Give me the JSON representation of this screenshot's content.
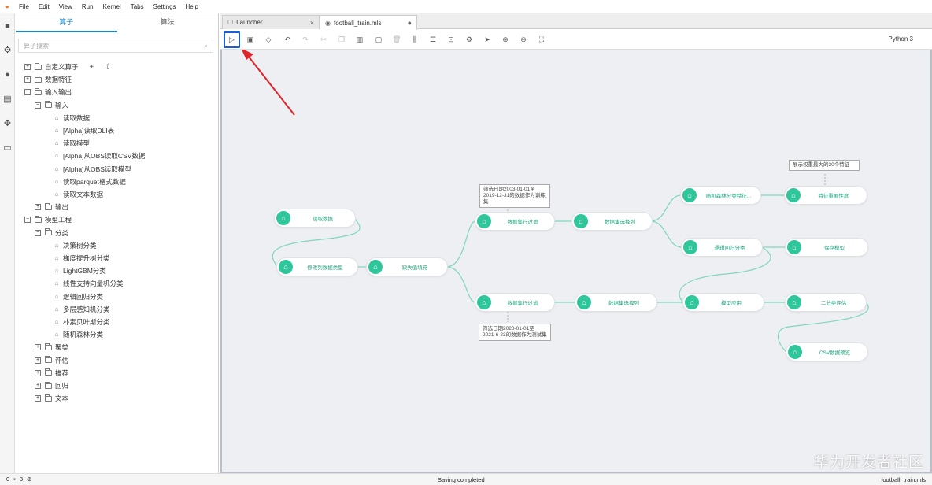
{
  "menubar": {
    "items": [
      "File",
      "Edit",
      "View",
      "Run",
      "Kernel",
      "Tabs",
      "Settings",
      "Help"
    ]
  },
  "sidebar": {
    "tabs": [
      "算子",
      "算法"
    ],
    "active_tab": "算子",
    "search_placeholder": "算子搜索",
    "tree": [
      {
        "label": "自定义算子",
        "expander": "+",
        "kind": "folder"
      },
      {
        "label": "数据特征",
        "expander": "+",
        "kind": "folder"
      },
      {
        "label": "输入输出",
        "expander": "−",
        "kind": "folder"
      },
      {
        "label": "输入",
        "expander": "−",
        "kind": "folder"
      },
      {
        "label": "读取数据",
        "kind": "leaf"
      },
      {
        "label": "[Alpha]读取DLI表",
        "kind": "leaf"
      },
      {
        "label": "读取模型",
        "kind": "leaf"
      },
      {
        "label": "[Alpha]从OBS读取CSV数据",
        "kind": "leaf"
      },
      {
        "label": "[Alpha]从OBS读取模型",
        "kind": "leaf"
      },
      {
        "label": "读取parquet格式数据",
        "kind": "leaf"
      },
      {
        "label": "读取文本数据",
        "kind": "leaf"
      },
      {
        "label": "输出",
        "expander": "+",
        "kind": "folder"
      },
      {
        "label": "模型工程",
        "expander": "−",
        "kind": "folder"
      },
      {
        "label": "分类",
        "expander": "−",
        "kind": "folder"
      },
      {
        "label": "决策树分类",
        "kind": "leaf"
      },
      {
        "label": "梯度提升树分类",
        "kind": "leaf"
      },
      {
        "label": "LightGBM分类",
        "kind": "leaf"
      },
      {
        "label": "线性支持向量机分类",
        "kind": "leaf"
      },
      {
        "label": "逻辑回归分类",
        "kind": "leaf"
      },
      {
        "label": "多层感知机分类",
        "kind": "leaf"
      },
      {
        "label": "朴素贝叶斯分类",
        "kind": "leaf"
      },
      {
        "label": "随机森林分类",
        "kind": "leaf"
      },
      {
        "label": "聚类",
        "expander": "+",
        "kind": "folder"
      },
      {
        "label": "评估",
        "expander": "+",
        "kind": "folder"
      },
      {
        "label": "推荐",
        "expander": "+",
        "kind": "folder"
      },
      {
        "label": "回归",
        "expander": "+",
        "kind": "folder"
      },
      {
        "label": "文本",
        "expander": "+",
        "kind": "folder"
      }
    ],
    "tree_actions": [
      "+",
      "⇧"
    ]
  },
  "doc_tabs": [
    {
      "label": "Launcher",
      "close": "×"
    },
    {
      "label": "football_train.mls",
      "close": "●"
    }
  ],
  "toolbar": {
    "kernel": "Python 3",
    "icons": [
      "run-icon",
      "save-icon",
      "eraser-icon",
      "undo-icon",
      "redo-icon",
      "cut-icon",
      "copy-icon",
      "paste-icon",
      "comment-icon",
      "delete-icon",
      "align-vertical-icon",
      "align-horizontal-icon",
      "export-icon",
      "settings-icon",
      "send-icon",
      "zoom-in-icon",
      "zoom-out-icon",
      "fit-icon"
    ]
  },
  "canvas": {
    "nodes": [
      {
        "id": "read",
        "label": "读取数据"
      },
      {
        "id": "cast",
        "label": "修改列数据类型"
      },
      {
        "id": "fill",
        "label": "缺失值填充"
      },
      {
        "id": "filter1",
        "label": "数据集行过滤"
      },
      {
        "id": "filter2",
        "label": "数据集行过滤"
      },
      {
        "id": "select1",
        "label": "数据集选择列"
      },
      {
        "id": "select2",
        "label": "数据集选择列"
      },
      {
        "id": "rfimp",
        "label": "随机森林分类特征..."
      },
      {
        "id": "lr",
        "label": "逻辑回归分类"
      },
      {
        "id": "predict",
        "label": "模型应用"
      },
      {
        "id": "featimp",
        "label": "特征重要性度"
      },
      {
        "id": "save",
        "label": "保存模型"
      },
      {
        "id": "binary",
        "label": "二分类评估"
      },
      {
        "id": "csv",
        "label": "CSV数据预览"
      }
    ],
    "notes": [
      {
        "id": "note-train",
        "text": "筛选日期2003-01-01至2019-12-31的数据作为训练集"
      },
      {
        "id": "note-test",
        "text": "筛选日期2020-01-01至2021-6-23的数据作为测试集"
      },
      {
        "id": "note-top30",
        "text": "展示权重最大的30个特征"
      }
    ]
  },
  "statusbar": {
    "left_num1": "0",
    "left_num2": "3",
    "message": "Saving completed",
    "filename": "football_train.mls"
  },
  "watermark": "华为开发者社区",
  "colors": {
    "accent": "#1a86c7",
    "node_green": "#2fc69b",
    "annotation_red": "#e0232b",
    "run_highlight": "#1c5fd0"
  }
}
